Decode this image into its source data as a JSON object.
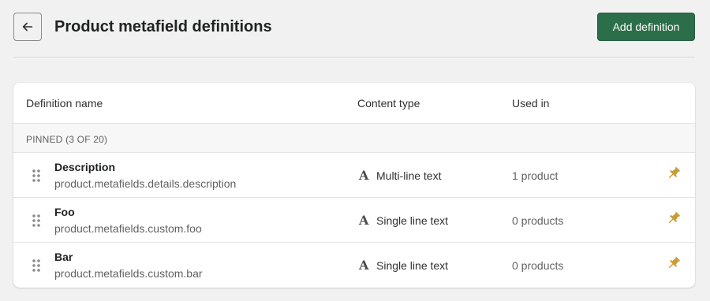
{
  "header": {
    "title": "Product metafield definitions",
    "add_button_label": "Add definition"
  },
  "table": {
    "columns": {
      "name": "Definition name",
      "content_type": "Content type",
      "used_in": "Used in"
    },
    "section_label": "PINNED (3 OF 20)",
    "rows": [
      {
        "name": "Description",
        "key": "product.metafields.details.description",
        "content_type": "Multi-line text",
        "used_in": "1 product",
        "pinned": true
      },
      {
        "name": "Foo",
        "key": "product.metafields.custom.foo",
        "content_type": "Single line text",
        "used_in": "0 products",
        "pinned": true
      },
      {
        "name": "Bar",
        "key": "product.metafields.custom.bar",
        "content_type": "Single line text",
        "used_in": "0 products",
        "pinned": true
      }
    ]
  },
  "colors": {
    "primary_button": "#2c6e49",
    "pin_icon": "#c99a2e",
    "section_bg": "#f7f7f7"
  },
  "icons": {
    "back": "arrow-left-icon",
    "drag": "drag-handle-icon",
    "text_type": "text-type-icon",
    "pin": "pin-icon"
  }
}
